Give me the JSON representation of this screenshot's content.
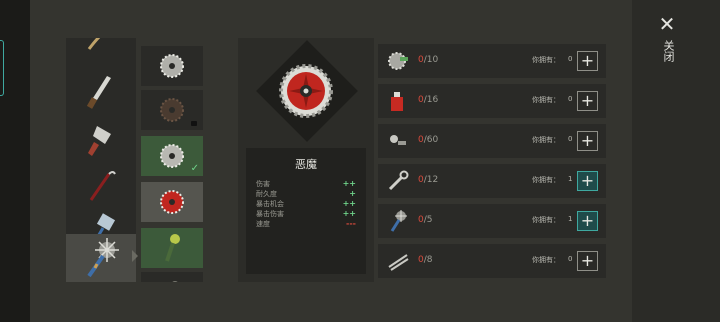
{
  "window": {
    "close_label": "关闭"
  },
  "tools": [
    {
      "icon": "curved-blade-icon",
      "selected": false
    },
    {
      "icon": "machete-icon",
      "selected": false
    },
    {
      "icon": "cleaver-icon",
      "selected": false
    },
    {
      "icon": "crowbar-icon",
      "selected": false
    },
    {
      "icon": "hammer-icon",
      "selected": false
    },
    {
      "icon": "spiked-mace-icon",
      "selected": true
    }
  ],
  "variants": [
    {
      "icon": "saw-blade-icon",
      "state": "default"
    },
    {
      "icon": "rusty-saw-blade-icon",
      "state": "locked"
    },
    {
      "icon": "saw-blade-icon",
      "state": "owned"
    },
    {
      "icon": "red-saw-blade-icon",
      "state": "active"
    },
    {
      "icon": "green-mace-icon",
      "state": "owned"
    },
    {
      "icon": "mace-icon",
      "state": "default"
    }
  ],
  "selected_item": {
    "icon": "red-saw-blade-icon",
    "name": "恶魔",
    "stats": [
      {
        "label": "伤害",
        "value": "++",
        "color": "#6fd38a"
      },
      {
        "label": "耐久度",
        "value": "+",
        "color": "#6fd38a"
      },
      {
        "label": "暴击机会",
        "value": "++",
        "color": "#6fd38a"
      },
      {
        "label": "暴击伤害",
        "value": "++",
        "color": "#6fd38a"
      },
      {
        "label": "速度",
        "value": "---",
        "color": "#d84a3c"
      }
    ]
  },
  "materials": [
    {
      "icon": "saw-blade-material-icon",
      "have": "0",
      "need": "/10",
      "own_label": "你拥有：",
      "own_count": "0",
      "plus": "+",
      "plus_active": false
    },
    {
      "icon": "paint-can-icon",
      "have": "0",
      "need": "/16",
      "own_label": "你拥有：",
      "own_count": "0",
      "plus": "+",
      "plus_active": false
    },
    {
      "icon": "nuts-bolts-icon",
      "have": "0",
      "need": "/60",
      "own_label": "你拥有：",
      "own_count": "0",
      "plus": "+",
      "plus_active": false
    },
    {
      "icon": "wrench-icon",
      "have": "0",
      "need": "/12",
      "own_label": "你拥有：",
      "own_count": "1",
      "plus": "+",
      "plus_active": true
    },
    {
      "icon": "spiked-mace-icon",
      "have": "0",
      "need": "/5",
      "own_label": "你拥有：",
      "own_count": "1",
      "plus": "+",
      "plus_active": true
    },
    {
      "icon": "metal-rods-icon",
      "have": "0",
      "need": "/8",
      "own_label": "你拥有：",
      "own_count": "0",
      "plus": "+",
      "plus_active": false
    }
  ]
}
